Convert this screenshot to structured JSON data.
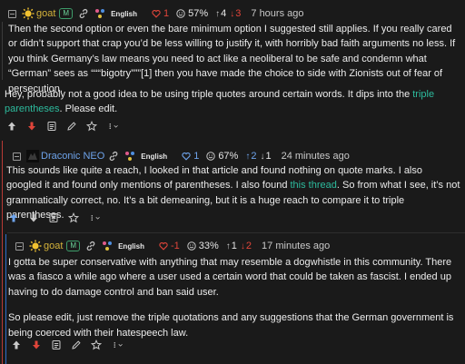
{
  "c1": {
    "username": "goat",
    "badge": "M",
    "language": "English",
    "likes": "1",
    "dislike_count": "3",
    "percent": "57%",
    "up": "4",
    "down": "3",
    "time": "7 hours ago",
    "quote": "Then the second option or even the bare minimum option I suggested still applies. If you really cared or didn’t support that crap you’d be less willing to justify it, with horribly bad faith arguments no less. If you think Germany’s law means you need to act like a neoliberal to be safe and condemn what “German” sees as “““bigotry”””[1] then you have made the choice to side with Zionists out of fear of persecution.",
    "body_pre": "Hey, probably not a good idea to be using triple quotes around certain words. It dips into the ",
    "body_link": "triple parentheses",
    "body_post": ". Please edit."
  },
  "c2": {
    "username": "Draconic NEO",
    "language": "English",
    "likes": "1",
    "percent": "67%",
    "up": "2",
    "down": "1",
    "time": "24 minutes ago",
    "body_pre": "This sounds like quite a reach, I looked in that article and found nothing on quote marks. I also googled it and found only mentions of parentheses. I also found ",
    "body_link": "this thread",
    "body_post": ". So from what I see, it’s not grammatically correct, no. It’s a bit demeaning, but it is a huge reach to compare it to triple parentheses."
  },
  "c3": {
    "username": "goat",
    "badge": "M",
    "language": "English",
    "likes": "-1",
    "percent": "33%",
    "up": "1",
    "down": "2",
    "time": "17 minutes ago",
    "p1": "I gotta be super conservative with anything that may resemble a dogwhistle in this community. There was a fiasco a while ago where a user used a certain word that could be taken as fascist. I ended up having to do damage control and ban said user.",
    "p2": "So please edit, just remove the triple quotations and any suggestions that the German government is being coerced with their hatespeech law."
  },
  "colors": {
    "background": "#1a1a1a",
    "username_gold": "#d4b23a",
    "username_blue": "#6ea3ea",
    "link_teal": "#2dbb9d",
    "downvote_red": "#e0453a",
    "mod_badge_green": "#3e9d6a"
  },
  "icons": [
    "collapse-icon",
    "sun-avatar-icon",
    "link-icon",
    "cross-post-icon",
    "heart-icon",
    "smile-icon",
    "arrow-up-icon",
    "arrow-down-icon",
    "reply-icon",
    "edit-icon",
    "star-icon",
    "more-icon"
  ]
}
